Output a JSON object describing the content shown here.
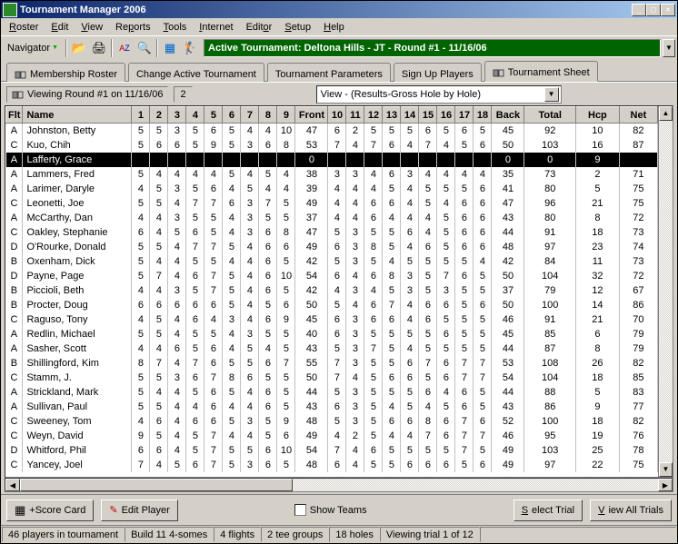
{
  "window": {
    "title": "Tournament Manager 2006"
  },
  "menu": [
    "Roster",
    "Edit",
    "View",
    "Reports",
    "Tools",
    "Internet",
    "Editor",
    "Setup",
    "Help"
  ],
  "toolbar": {
    "navigator": "Navigator"
  },
  "active_tournament": "Active Tournament: Deltona Hills - JT - Round #1 - 11/16/06",
  "tabs": [
    "Membership Roster",
    "Change Active Tournament",
    "Tournament Parameters",
    "Sign Up Players",
    "Tournament Sheet"
  ],
  "subbar": {
    "viewing": "Viewing Round #1 on 11/16/06",
    "page": "2",
    "view_select": "View - (Results-Gross Hole by Hole)"
  },
  "columns": [
    "Flt",
    "Name",
    "1",
    "2",
    "3",
    "4",
    "5",
    "6",
    "7",
    "8",
    "9",
    "Front",
    "10",
    "11",
    "12",
    "13",
    "14",
    "15",
    "16",
    "17",
    "18",
    "Back",
    "Total",
    "Hcp",
    "Net"
  ],
  "rows": [
    {
      "flt": "A",
      "name": "Johnston, Betty",
      "h": [
        "5",
        "5",
        "3",
        "5",
        "6",
        "5",
        "4",
        "4",
        "10",
        "47",
        "6",
        "2",
        "5",
        "5",
        "5",
        "6",
        "5",
        "6",
        "5",
        "45",
        "92",
        "10",
        "82"
      ]
    },
    {
      "flt": "C",
      "name": "Kuo, Chih",
      "h": [
        "5",
        "6",
        "6",
        "5",
        "9",
        "5",
        "3",
        "6",
        "8",
        "53",
        "7",
        "4",
        "7",
        "6",
        "4",
        "7",
        "4",
        "5",
        "6",
        "50",
        "103",
        "16",
        "87"
      ]
    },
    {
      "flt": "A",
      "name": "Lafferty, Grace",
      "h": [
        "",
        "",
        "",
        "",
        "",
        "",
        "",
        "",
        "",
        "0",
        "",
        "",
        "",
        "",
        "",
        "",
        "",
        "",
        "",
        "0",
        "0",
        "9",
        ""
      ],
      "sel": true
    },
    {
      "flt": "A",
      "name": "Lammers, Fred",
      "h": [
        "5",
        "4",
        "4",
        "4",
        "4",
        "5",
        "4",
        "5",
        "4",
        "38",
        "3",
        "3",
        "4",
        "6",
        "3",
        "4",
        "4",
        "4",
        "4",
        "35",
        "73",
        "2",
        "71"
      ]
    },
    {
      "flt": "A",
      "name": "Larimer, Daryle",
      "h": [
        "4",
        "5",
        "3",
        "5",
        "6",
        "4",
        "5",
        "4",
        "4",
        "39",
        "4",
        "4",
        "4",
        "5",
        "4",
        "5",
        "5",
        "5",
        "6",
        "41",
        "80",
        "5",
        "75"
      ]
    },
    {
      "flt": "C",
      "name": "Leonetti, Joe",
      "h": [
        "5",
        "5",
        "4",
        "7",
        "7",
        "6",
        "3",
        "7",
        "5",
        "49",
        "4",
        "4",
        "6",
        "6",
        "4",
        "5",
        "4",
        "6",
        "6",
        "47",
        "96",
        "21",
        "75"
      ]
    },
    {
      "flt": "A",
      "name": "McCarthy, Dan",
      "h": [
        "4",
        "4",
        "3",
        "5",
        "5",
        "4",
        "3",
        "5",
        "5",
        "37",
        "4",
        "4",
        "6",
        "4",
        "4",
        "4",
        "5",
        "6",
        "6",
        "43",
        "80",
        "8",
        "72"
      ]
    },
    {
      "flt": "C",
      "name": "Oakley, Stephanie",
      "h": [
        "6",
        "4",
        "5",
        "6",
        "5",
        "4",
        "3",
        "6",
        "8",
        "47",
        "5",
        "3",
        "5",
        "5",
        "6",
        "4",
        "5",
        "6",
        "6",
        "44",
        "91",
        "18",
        "73"
      ]
    },
    {
      "flt": "D",
      "name": "O'Rourke, Donald",
      "h": [
        "5",
        "5",
        "4",
        "7",
        "7",
        "5",
        "4",
        "6",
        "6",
        "49",
        "6",
        "3",
        "8",
        "5",
        "4",
        "6",
        "5",
        "6",
        "6",
        "48",
        "97",
        "23",
        "74"
      ]
    },
    {
      "flt": "B",
      "name": "Oxenham, Dick",
      "h": [
        "5",
        "4",
        "4",
        "5",
        "5",
        "4",
        "4",
        "6",
        "5",
        "42",
        "5",
        "3",
        "5",
        "4",
        "5",
        "5",
        "5",
        "5",
        "4",
        "42",
        "84",
        "11",
        "73"
      ]
    },
    {
      "flt": "D",
      "name": "Payne, Page",
      "h": [
        "5",
        "7",
        "4",
        "6",
        "7",
        "5",
        "4",
        "6",
        "10",
        "54",
        "6",
        "4",
        "6",
        "8",
        "3",
        "5",
        "7",
        "6",
        "5",
        "50",
        "104",
        "32",
        "72"
      ]
    },
    {
      "flt": "B",
      "name": "Piccioli, Beth",
      "h": [
        "4",
        "4",
        "3",
        "5",
        "7",
        "5",
        "4",
        "6",
        "5",
        "42",
        "4",
        "3",
        "4",
        "5",
        "3",
        "5",
        "3",
        "5",
        "5",
        "37",
        "79",
        "12",
        "67"
      ]
    },
    {
      "flt": "B",
      "name": "Procter, Doug",
      "h": [
        "6",
        "6",
        "6",
        "6",
        "6",
        "5",
        "4",
        "5",
        "6",
        "50",
        "5",
        "4",
        "6",
        "7",
        "4",
        "6",
        "6",
        "5",
        "6",
        "50",
        "100",
        "14",
        "86"
      ]
    },
    {
      "flt": "C",
      "name": "Raguso, Tony",
      "h": [
        "4",
        "5",
        "4",
        "6",
        "4",
        "3",
        "4",
        "6",
        "9",
        "45",
        "6",
        "3",
        "6",
        "6",
        "4",
        "6",
        "5",
        "5",
        "5",
        "46",
        "91",
        "21",
        "70"
      ]
    },
    {
      "flt": "A",
      "name": "Redlin, Michael",
      "h": [
        "5",
        "5",
        "4",
        "5",
        "5",
        "4",
        "3",
        "5",
        "5",
        "40",
        "6",
        "3",
        "5",
        "5",
        "5",
        "5",
        "6",
        "5",
        "5",
        "45",
        "85",
        "6",
        "79"
      ]
    },
    {
      "flt": "A",
      "name": "Sasher, Scott",
      "h": [
        "4",
        "4",
        "6",
        "5",
        "6",
        "4",
        "5",
        "4",
        "5",
        "43",
        "5",
        "3",
        "7",
        "5",
        "4",
        "5",
        "5",
        "5",
        "5",
        "44",
        "87",
        "8",
        "79"
      ]
    },
    {
      "flt": "B",
      "name": "Shillingford, Kim",
      "h": [
        "8",
        "7",
        "4",
        "7",
        "6",
        "5",
        "5",
        "6",
        "7",
        "55",
        "7",
        "3",
        "5",
        "5",
        "6",
        "7",
        "6",
        "7",
        "7",
        "53",
        "108",
        "26",
        "82"
      ]
    },
    {
      "flt": "C",
      "name": "Stamm, J.",
      "h": [
        "5",
        "5",
        "3",
        "6",
        "7",
        "8",
        "6",
        "5",
        "5",
        "50",
        "7",
        "4",
        "5",
        "6",
        "6",
        "5",
        "6",
        "7",
        "7",
        "54",
        "104",
        "18",
        "85"
      ]
    },
    {
      "flt": "A",
      "name": "Strickland, Mark",
      "h": [
        "5",
        "4",
        "4",
        "5",
        "6",
        "5",
        "4",
        "6",
        "5",
        "44",
        "5",
        "3",
        "5",
        "5",
        "5",
        "6",
        "4",
        "6",
        "5",
        "44",
        "88",
        "5",
        "83"
      ]
    },
    {
      "flt": "A",
      "name": "Sullivan, Paul",
      "h": [
        "5",
        "5",
        "4",
        "4",
        "6",
        "4",
        "4",
        "6",
        "5",
        "43",
        "6",
        "3",
        "5",
        "4",
        "5",
        "4",
        "5",
        "6",
        "5",
        "43",
        "86",
        "9",
        "77"
      ]
    },
    {
      "flt": "C",
      "name": "Sweeney, Tom",
      "h": [
        "4",
        "6",
        "4",
        "6",
        "6",
        "5",
        "3",
        "5",
        "9",
        "48",
        "5",
        "3",
        "5",
        "6",
        "6",
        "8",
        "6",
        "7",
        "6",
        "52",
        "100",
        "18",
        "82"
      ]
    },
    {
      "flt": "C",
      "name": "Weyn, David",
      "h": [
        "9",
        "5",
        "4",
        "5",
        "7",
        "4",
        "4",
        "5",
        "6",
        "49",
        "4",
        "2",
        "5",
        "4",
        "4",
        "7",
        "6",
        "7",
        "7",
        "46",
        "95",
        "19",
        "76"
      ]
    },
    {
      "flt": "D",
      "name": "Whitford, Phil",
      "h": [
        "6",
        "6",
        "4",
        "5",
        "7",
        "5",
        "5",
        "6",
        "10",
        "54",
        "7",
        "4",
        "6",
        "5",
        "5",
        "5",
        "5",
        "7",
        "5",
        "49",
        "103",
        "25",
        "78"
      ]
    },
    {
      "flt": "C",
      "name": "Yancey, Joel",
      "h": [
        "7",
        "4",
        "5",
        "6",
        "7",
        "5",
        "3",
        "6",
        "5",
        "48",
        "6",
        "4",
        "5",
        "5",
        "6",
        "6",
        "6",
        "5",
        "6",
        "49",
        "97",
        "22",
        "75"
      ]
    }
  ],
  "bottom": {
    "scorecard": "+Score Card",
    "editplayer": "Edit Player",
    "showteams": "Show Teams",
    "selecttrial": "Select Trial",
    "viewall": "View All Trials"
  },
  "status": {
    "players": "46 players in tournament",
    "build": "Build 11 4-somes",
    "flights": "4 flights",
    "tee": "2 tee groups",
    "holes": "18 holes",
    "trial": "Viewing trial 1 of  12"
  }
}
